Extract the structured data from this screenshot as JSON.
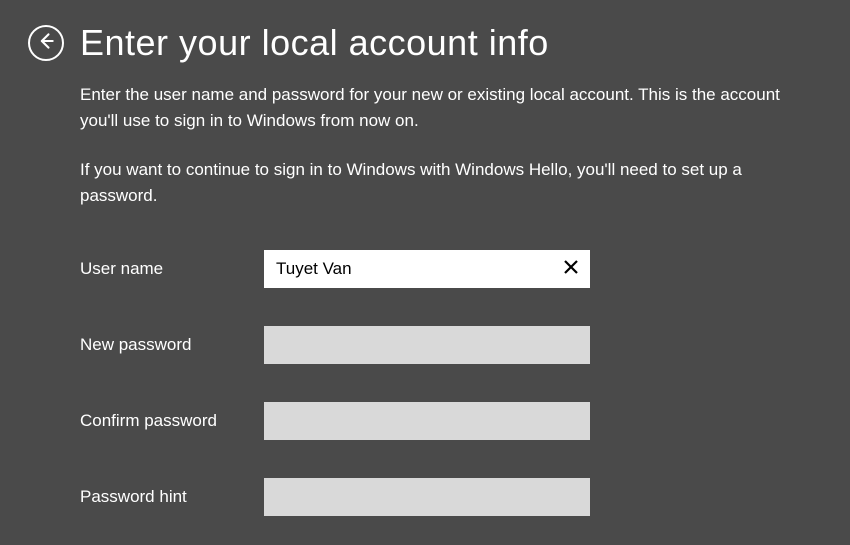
{
  "header": {
    "title": "Enter your local account info"
  },
  "description": {
    "p1": "Enter the user name and password for your new or existing local account. This is the account you'll use to sign in to Windows from now on.",
    "p2": "If you want to continue to sign in to Windows with Windows Hello, you'll need to set up a password."
  },
  "form": {
    "username": {
      "label": "User name",
      "value": "Tuyet Van"
    },
    "newPassword": {
      "label": "New password",
      "value": ""
    },
    "confirmPassword": {
      "label": "Confirm password",
      "value": ""
    },
    "passwordHint": {
      "label": "Password hint",
      "value": ""
    }
  }
}
